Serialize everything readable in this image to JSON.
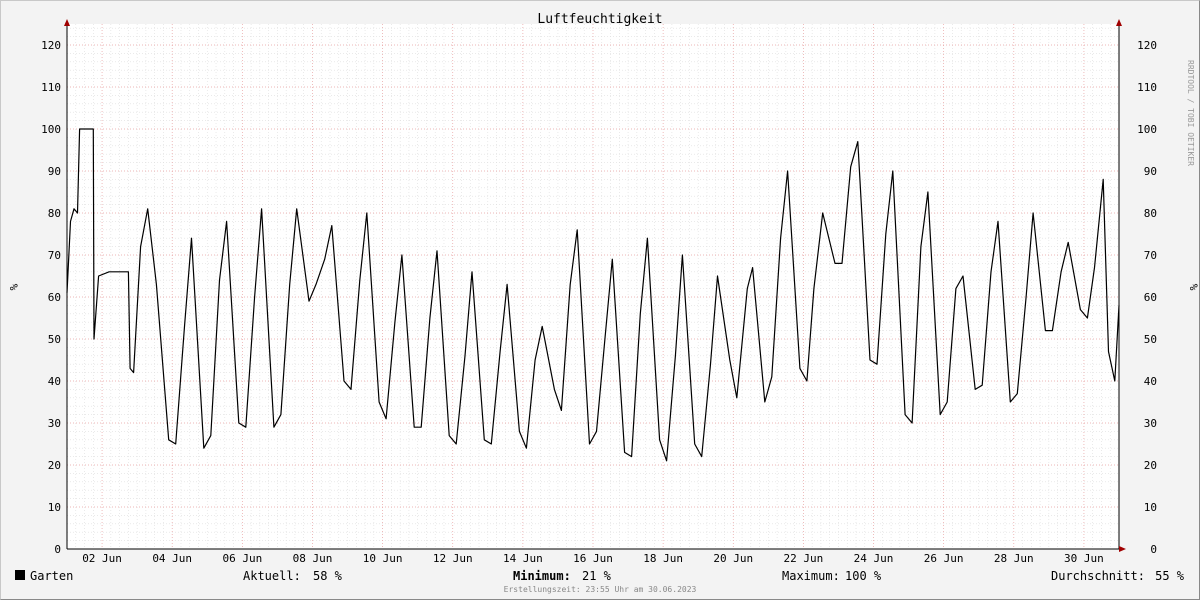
{
  "chart_data": {
    "type": "line",
    "title": "Luftfeuchtigkeit",
    "ylabel": "%",
    "ylim": [
      0,
      125
    ],
    "yticks": [
      0,
      10,
      20,
      30,
      40,
      50,
      60,
      70,
      80,
      90,
      100,
      110,
      120
    ],
    "xlim": [
      1,
      31
    ],
    "xticks": [
      {
        "day": 2,
        "label": "02 Jun"
      },
      {
        "day": 4,
        "label": "04 Jun"
      },
      {
        "day": 6,
        "label": "06 Jun"
      },
      {
        "day": 8,
        "label": "08 Jun"
      },
      {
        "day": 10,
        "label": "10 Jun"
      },
      {
        "day": 12,
        "label": "12 Jun"
      },
      {
        "day": 14,
        "label": "14 Jun"
      },
      {
        "day": 16,
        "label": "16 Jun"
      },
      {
        "day": 18,
        "label": "18 Jun"
      },
      {
        "day": 20,
        "label": "20 Jun"
      },
      {
        "day": 22,
        "label": "22 Jun"
      },
      {
        "day": 24,
        "label": "24 Jun"
      },
      {
        "day": 26,
        "label": "26 Jun"
      },
      {
        "day": 28,
        "label": "28 Jun"
      },
      {
        "day": 30,
        "label": "30 Jun"
      }
    ],
    "grid": true,
    "series": [
      {
        "name": "Garten",
        "color": "#000000",
        "x": [
          1.0,
          1.1,
          1.2,
          1.3,
          1.36,
          1.5,
          1.75,
          1.77,
          1.9,
          2.2,
          2.75,
          2.8,
          2.9,
          3.1,
          3.3,
          3.55,
          3.9,
          4.1,
          4.35,
          4.55,
          4.9,
          5.1,
          5.35,
          5.55,
          5.9,
          6.1,
          6.35,
          6.55,
          6.9,
          7.1,
          7.35,
          7.55,
          7.9,
          8.1,
          8.35,
          8.55,
          8.9,
          9.1,
          9.35,
          9.55,
          9.9,
          10.1,
          10.35,
          10.55,
          10.9,
          11.1,
          11.35,
          11.55,
          11.9,
          12.1,
          12.35,
          12.55,
          12.9,
          13.1,
          13.35,
          13.55,
          13.9,
          14.1,
          14.35,
          14.55,
          14.9,
          15.1,
          15.35,
          15.55,
          15.9,
          16.1,
          16.35,
          16.55,
          16.9,
          17.1,
          17.35,
          17.55,
          17.9,
          18.1,
          18.35,
          18.55,
          18.9,
          19.1,
          19.35,
          19.55,
          19.9,
          20.1,
          20.4,
          20.55,
          20.9,
          21.1,
          21.35,
          21.55,
          21.9,
          22.1,
          22.3,
          22.55,
          22.9,
          23.1,
          23.35,
          23.55,
          23.9,
          24.1,
          24.35,
          24.55,
          24.9,
          25.1,
          25.35,
          25.55,
          25.9,
          26.1,
          26.35,
          26.55,
          26.9,
          27.1,
          27.35,
          27.55,
          27.9,
          28.1,
          28.35,
          28.55,
          28.9,
          29.1,
          29.35,
          29.55,
          29.9,
          30.1,
          30.3,
          30.55,
          30.7,
          30.88,
          31.0
        ],
        "values": [
          61,
          78,
          81,
          80,
          100,
          100,
          100,
          50,
          65,
          66,
          66,
          43,
          42,
          72,
          81,
          63,
          26,
          25,
          53,
          74,
          24,
          27,
          64,
          78,
          30,
          29,
          60,
          81,
          29,
          32,
          63,
          81,
          59,
          63,
          69,
          77,
          40,
          38,
          64,
          80,
          35,
          31,
          54,
          70,
          29,
          29,
          55,
          71,
          27,
          25,
          46,
          66,
          26,
          25,
          47,
          63,
          28,
          24,
          45,
          53,
          38,
          33,
          63,
          76,
          25,
          28,
          51,
          69,
          23,
          22,
          56,
          74,
          26,
          21,
          46,
          70,
          25,
          22,
          44,
          65,
          45,
          36,
          62,
          67,
          35,
          41,
          74,
          90,
          43,
          40,
          62,
          80,
          68,
          68,
          91,
          97,
          45,
          44,
          75,
          90,
          32,
          30,
          72,
          85,
          32,
          35,
          62,
          65,
          38,
          39,
          66,
          78,
          35,
          37,
          60,
          80,
          52,
          52,
          66,
          73,
          57,
          55,
          67,
          88,
          47,
          40,
          58
        ]
      }
    ],
    "legend": {
      "series_name": "Garten",
      "aktuell_label": "Aktuell:",
      "aktuell_value": "58 %",
      "minimum_label": "Minimum:",
      "minimum_value": "21 %",
      "maximum_label": "Maximum:",
      "maximum_value": "100 %",
      "avg_label": "Durchschnitt:",
      "avg_value": "55 %"
    },
    "footer": "Erstellungszeit: 23:55 Uhr am 30.06.2023",
    "watermark": "RRDTOOL / TOBI OETIKER"
  }
}
